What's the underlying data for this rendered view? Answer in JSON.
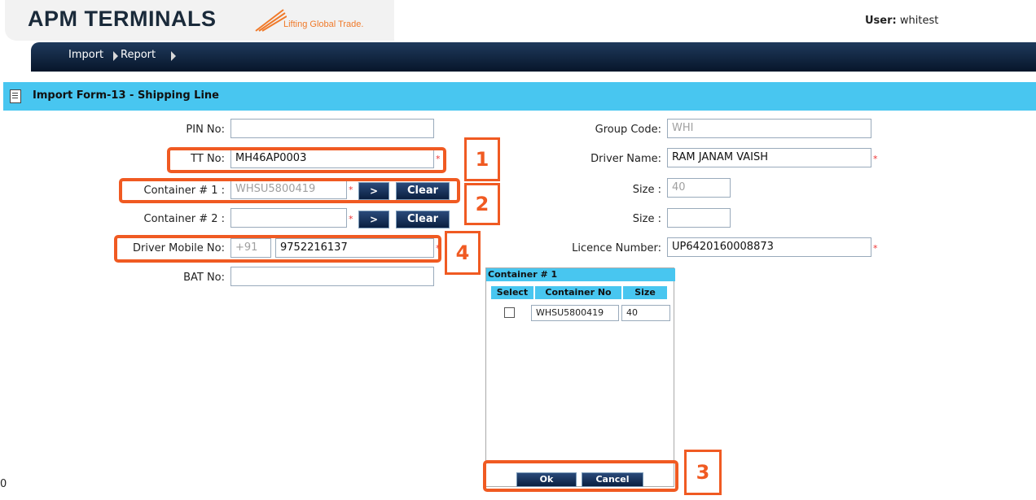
{
  "header": {
    "logo_text": "APM TERMINALS",
    "tagline": "Lifting Global Trade.",
    "user_label": "User:",
    "user_name": "whitest"
  },
  "nav": {
    "items": [
      "Import",
      "Report"
    ]
  },
  "page_title": "Import Form-13 - Shipping Line",
  "form": {
    "pin_no": {
      "label": "PIN No:",
      "value": ""
    },
    "tt_no": {
      "label": "TT No:",
      "value": "MH46AP0003"
    },
    "container1": {
      "label": "Container # 1 :",
      "value": "WHSU5800419",
      "go": ">",
      "clear": "Clear"
    },
    "container2": {
      "label": "Container # 2 :",
      "value": "",
      "go": ">",
      "clear": "Clear"
    },
    "driver_mobile": {
      "label": "Driver Mobile No:",
      "prefix": "+91",
      "value": "9752216137"
    },
    "bat_no": {
      "label": "BAT No:",
      "value": ""
    },
    "group_code": {
      "label": "Group Code:",
      "value": "WHI"
    },
    "driver_name": {
      "label": "Driver Name:",
      "value": "RAM JANAM VAISH"
    },
    "size1": {
      "label": "Size :",
      "value": "40"
    },
    "size2": {
      "label": "Size :",
      "value": ""
    },
    "licence_number": {
      "label": "Licence Number:",
      "value": "UP6420160008873"
    },
    "required_mark": "*"
  },
  "popup": {
    "title": "Container # 1",
    "columns": [
      "Select",
      "Container No",
      "Size"
    ],
    "rows": [
      {
        "container_no": "WHSU5800419",
        "size": "40"
      }
    ],
    "ok": "Ok",
    "cancel": "Cancel"
  },
  "annotations": [
    "1",
    "2",
    "3",
    "4"
  ],
  "stray_text": "0",
  "colors": {
    "accent_bar": "#48c6f0",
    "nav_bg": "#0a1f3a",
    "annotation": "#f05a22"
  }
}
